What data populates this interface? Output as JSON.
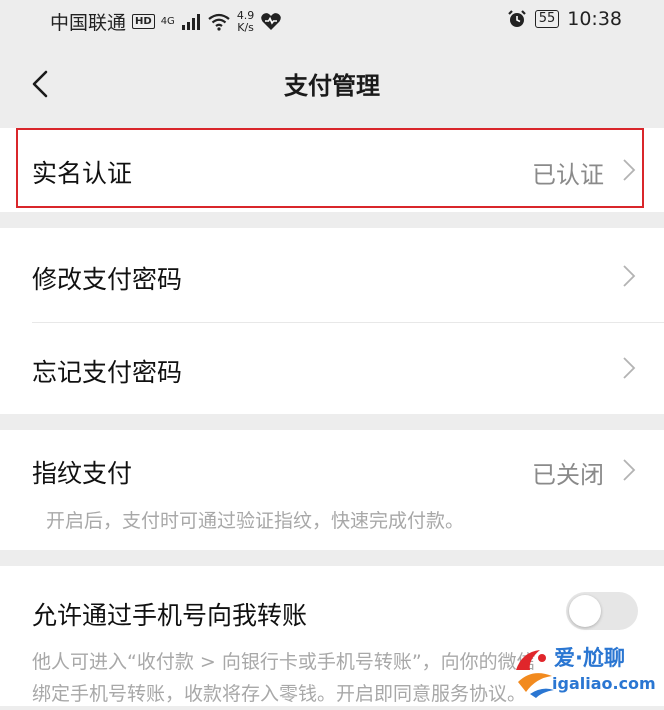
{
  "status_bar": {
    "carrier": "中国联通",
    "hd": "HD",
    "network": "4G",
    "speed_value": "4.9",
    "speed_unit": "K/s",
    "battery": "55",
    "time": "10:38"
  },
  "nav": {
    "title": "支付管理"
  },
  "sections": {
    "realname": {
      "label": "实名认证",
      "value": "已认证"
    },
    "change_password": {
      "label": "修改支付密码"
    },
    "forgot_password": {
      "label": "忘记支付密码"
    },
    "fingerprint": {
      "label": "指纹支付",
      "value": "已关闭",
      "description": "开启后，支付时可通过验证指纹，快速完成付款。"
    },
    "phone_transfer": {
      "label": "允许通过手机号向我转账",
      "toggle_on": false,
      "description_line1": "他人可进入“收付款 > 向银行卡或手机号转账”，向你的微信",
      "description_line2": "绑定手机号转账，收款将存入零钱。开启即同意服务协议。"
    }
  },
  "watermark": {
    "line1": "爱·尬聊",
    "line2": "igaliao.com"
  },
  "colors": {
    "highlight": "#d9262b",
    "background": "#ededed",
    "card": "#ffffff",
    "watermark": "#2a76d2"
  }
}
